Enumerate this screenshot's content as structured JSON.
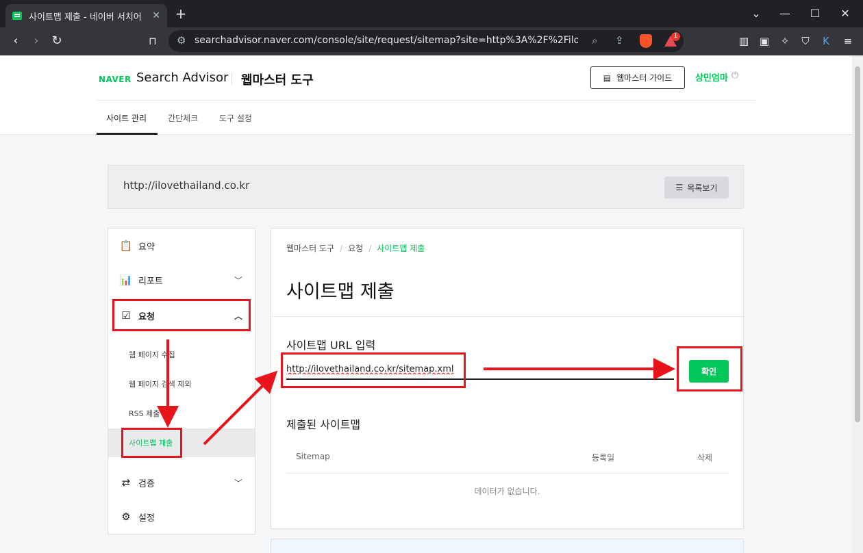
{
  "browser": {
    "tab_title": "사이트맵 제출 - 네이버 서치어",
    "url": "searchadvisor.naver.com/console/site/request/sitemap?site=http%3A%2F%2Filovethaila...",
    "rewards_badge": "1"
  },
  "header": {
    "logo": "NAVER",
    "product": "Search Advisor",
    "tool_name": "웹마스터 도구",
    "guide_label": "웹마스터 가이드",
    "user": "상민엄마"
  },
  "gnb": [
    "사이트 관리",
    "간단체크",
    "도구 설정"
  ],
  "site": {
    "url": "http://ilovethailand.co.kr",
    "list_label": "목록보기"
  },
  "sidebar": {
    "items": [
      "요약",
      "리포트",
      "요청",
      "검증",
      "설정"
    ],
    "sub_items": [
      "웹 페이지 수집",
      "웹 페이지 검색 제외",
      "RSS 제출",
      "사이트맵 제출"
    ]
  },
  "main": {
    "breadcrumb": [
      "웹마스터 도구",
      "요청",
      "사이트맵 제출"
    ],
    "title": "사이트맵 제출",
    "input_section": "사이트맵 URL 입력",
    "input_value": "http://ilovethailand.co.kr/sitemap.xml",
    "confirm_label": "확인",
    "submitted_section": "제출된 사이트맵",
    "columns": [
      "Sitemap",
      "등록일",
      "삭제"
    ],
    "empty_text": "데이터가 없습니다."
  },
  "colors": {
    "naver_green": "#03c75a",
    "annotation_red": "#e8141b"
  }
}
